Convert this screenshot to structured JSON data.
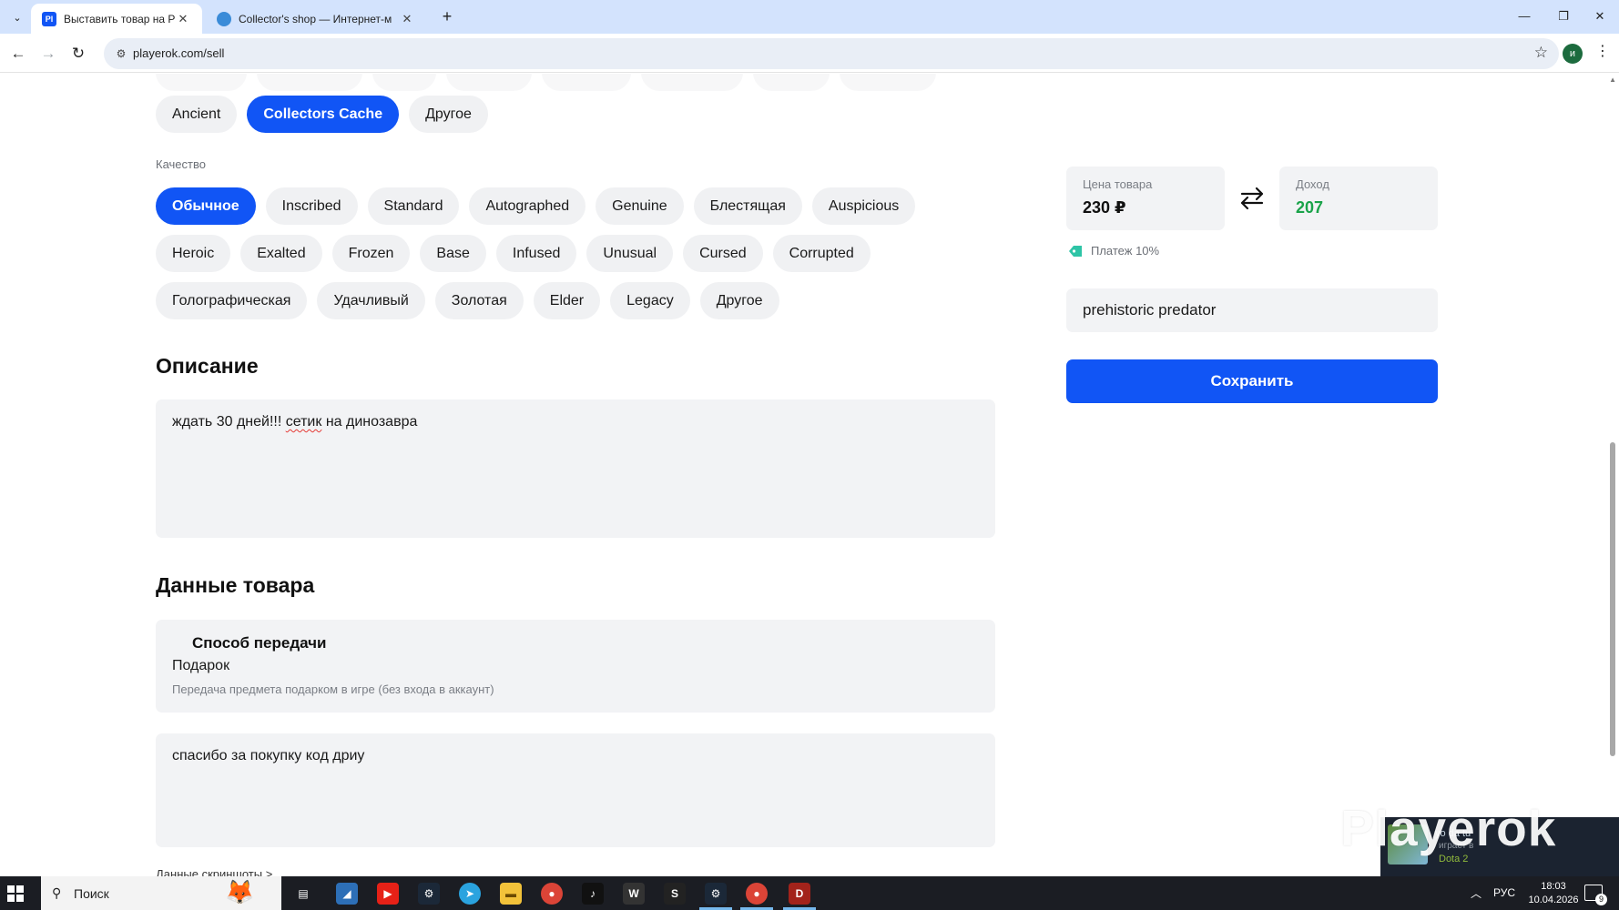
{
  "browser": {
    "tabs": [
      {
        "title": "Выставить товар на Playerok",
        "favicon": "Pl",
        "active": true
      },
      {
        "title": "Collector's shop — Интернет-м",
        "favicon": "",
        "active": false
      }
    ],
    "url": "playerok.com/sell",
    "profile_initial": "и"
  },
  "page": {
    "type_chips_row1": [
      "Ancient",
      "Collectors Cache",
      "Другое"
    ],
    "type_selected": "Collectors Cache",
    "quality_label": "Качество",
    "quality_row1": [
      "Обычное",
      "Inscribed",
      "Standard",
      "Autographed",
      "Genuine",
      "Блестящая",
      "Auspicious"
    ],
    "quality_row2": [
      "Heroic",
      "Exalted",
      "Frozen",
      "Base",
      "Infused",
      "Unusual",
      "Cursed",
      "Corrupted"
    ],
    "quality_row3": [
      "Голографическая",
      "Удачливый",
      "Золотая",
      "Elder",
      "Legacy",
      "Другое"
    ],
    "quality_selected": "Обычное",
    "description_heading": "Описание",
    "description_text_before": "ждать 30 дней!!! ",
    "description_text_misspelled": "сетик",
    "description_text_after": " на динозавра",
    "item_data_heading": "Данные товара",
    "transfer": {
      "title": "Способ передачи",
      "value": "Подарок",
      "description": "Передача предмета подарком в игре (без входа в аккаунт)"
    },
    "delivery_text": "спасибо за покупку код дриу",
    "screenshots_link": "Данные скриншоты >"
  },
  "sidebar": {
    "price_label": "Цена товара",
    "price_value": "230 ₽",
    "income_label": "Доход",
    "income_value": "207",
    "fee_text": "Платеж 10%",
    "item_name": "prehistoric predator",
    "save_label": "Сохранить"
  },
  "overlay": {
    "watermark": "Playerok",
    "steam_name": "yo da tu",
    "steam_status": "играет в",
    "steam_game": "Dota 2"
  },
  "taskbar": {
    "search_placeholder": "Поиск",
    "lang": "РУС",
    "time": "18:03",
    "date": "10.04.2026",
    "notifications": "9"
  },
  "colors": {
    "accent": "#1155f5",
    "income": "#1aa34a",
    "chip_bg": "#f0f1f3"
  }
}
